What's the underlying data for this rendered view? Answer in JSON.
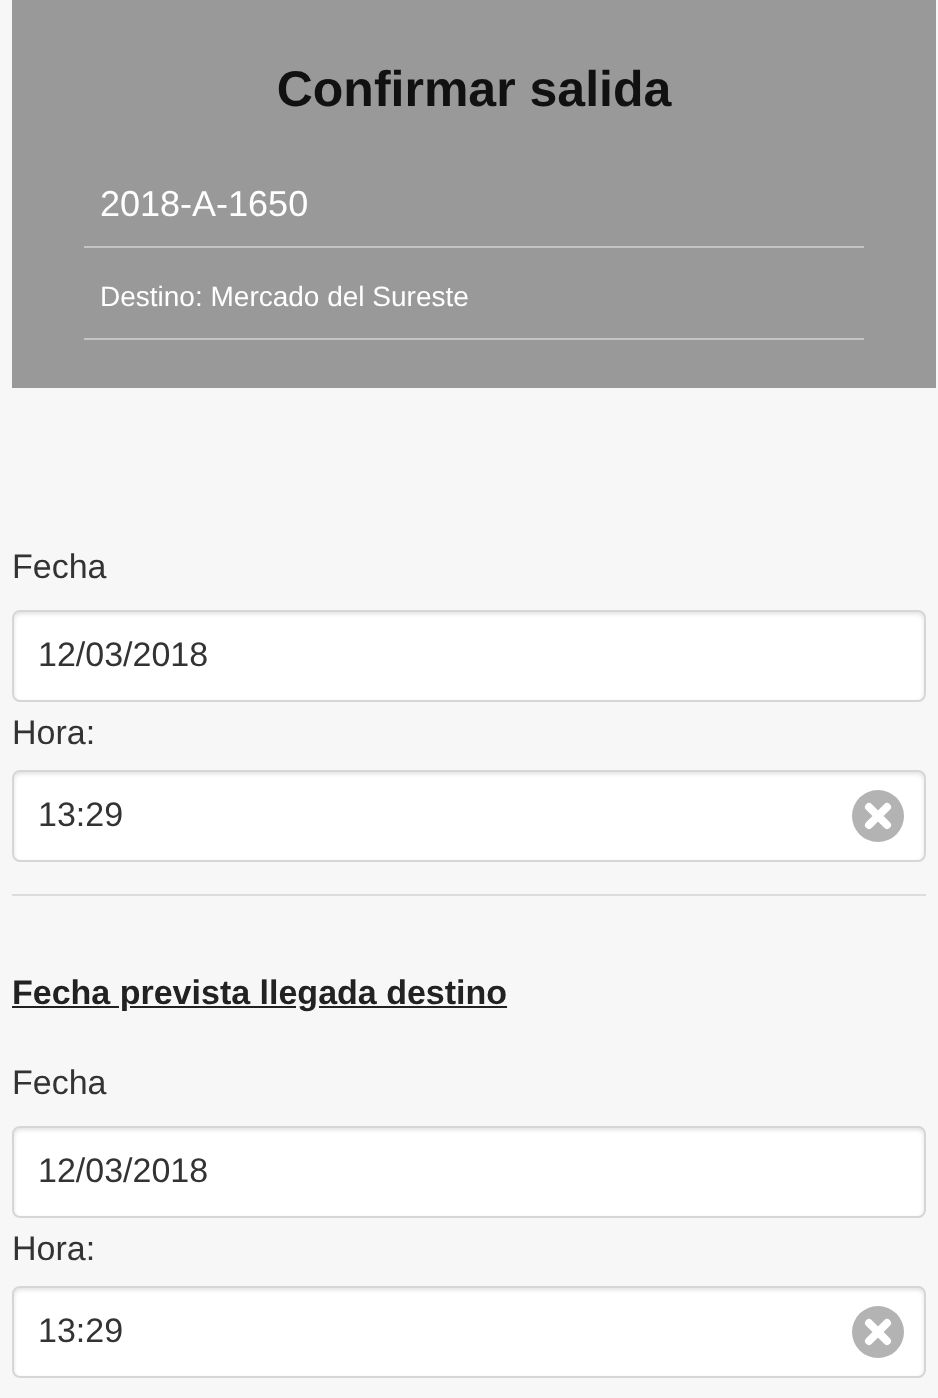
{
  "header": {
    "title": "Confirmar salida",
    "lines": [
      {
        "text": "2018-A-1650",
        "kind": "code"
      },
      {
        "text": "Destino: Mercado del Sureste",
        "kind": "detail"
      }
    ]
  },
  "sections": [
    {
      "fields": [
        {
          "label": "Fecha",
          "value": "12/03/2018",
          "kind": "date"
        },
        {
          "label": "Hora:",
          "value": "13:29",
          "kind": "time"
        }
      ]
    },
    {
      "heading": "Fecha prevista llegada destino",
      "fields": [
        {
          "label": "Fecha",
          "value": "12/03/2018",
          "kind": "date"
        },
        {
          "label": "Hora:",
          "value": "13:29",
          "kind": "time"
        }
      ]
    }
  ]
}
